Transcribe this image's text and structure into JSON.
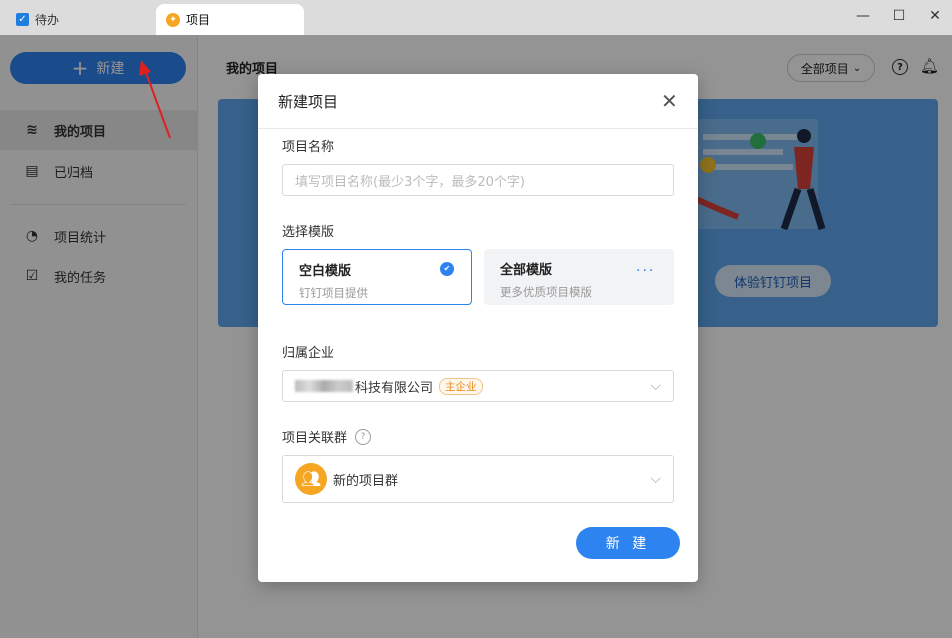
{
  "tabs": [
    {
      "label": "待办"
    },
    {
      "label": "项目"
    }
  ],
  "window": {
    "minimize": "—",
    "maximize": "☐",
    "close": "✕"
  },
  "sidebar": {
    "new_button": "新建",
    "items": [
      {
        "label": "我的项目",
        "icon": "layers-icon"
      },
      {
        "label": "已归档",
        "icon": "archive-icon"
      },
      {
        "label": "项目统计",
        "icon": "pie-chart-icon"
      },
      {
        "label": "我的任务",
        "icon": "checkbox-icon"
      }
    ]
  },
  "main": {
    "title": "我的项目",
    "filter": "全部项目",
    "banner_button": "体验钉钉项目"
  },
  "modal": {
    "title": "新建项目",
    "name_label": "项目名称",
    "name_placeholder": "填写项目名称(最少3个字，最多20个字)",
    "template_label": "选择模版",
    "templates": [
      {
        "name": "空白模版",
        "desc": "钉钉项目提供",
        "selected": true
      },
      {
        "name": "全部模版",
        "desc": "更多优质项目模版",
        "selected": false
      }
    ],
    "company_label": "归属企业",
    "company_value": "科技有限公司",
    "company_badge": "主企业",
    "group_label": "项目关联群",
    "group_value": "新的项目群",
    "submit": "新 建"
  },
  "colors": {
    "accent": "#2d84f0",
    "badge": "#e88a1a",
    "group_icon": "#f5a623"
  }
}
